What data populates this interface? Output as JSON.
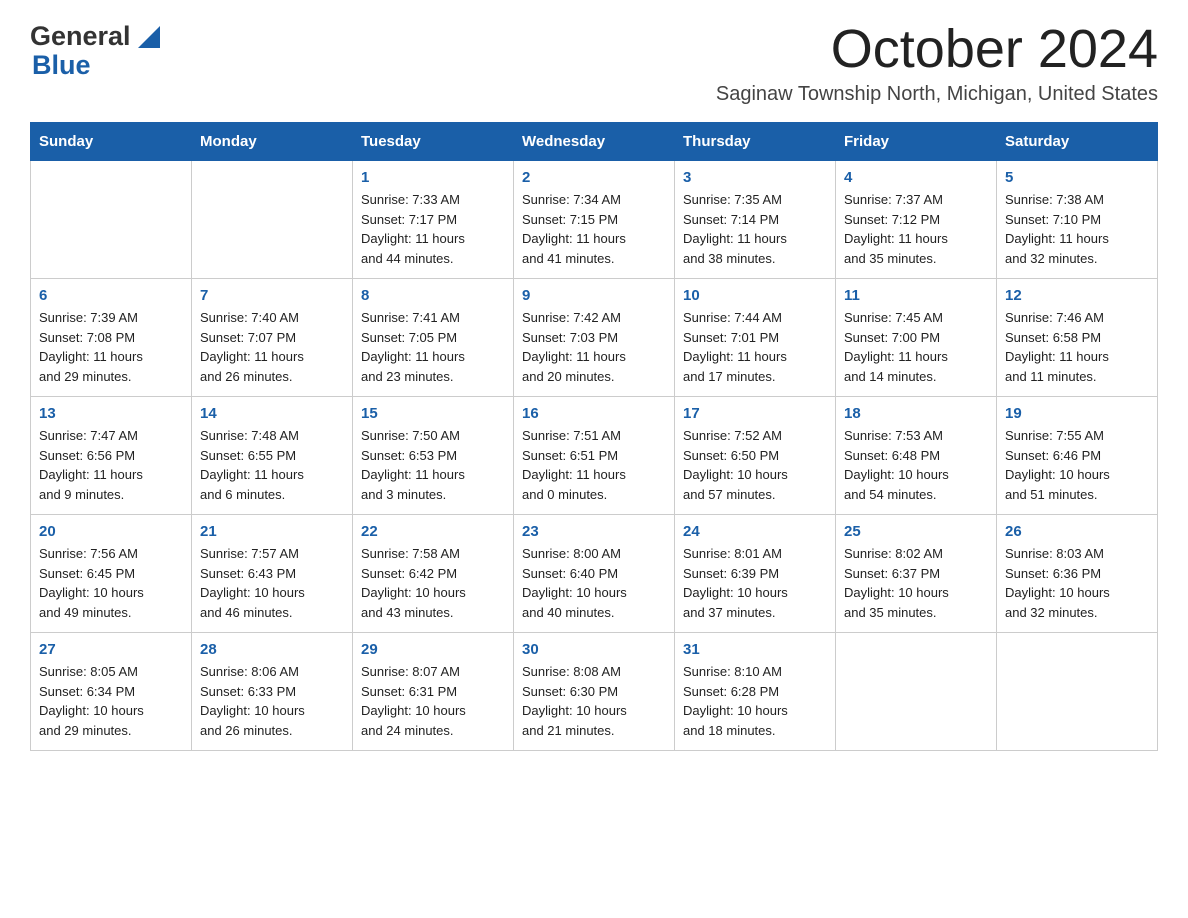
{
  "header": {
    "logo": {
      "general": "General",
      "blue": "Blue",
      "triangle_color": "#1a5fa8"
    },
    "title": "October 2024",
    "subtitle": "Saginaw Township North, Michigan, United States"
  },
  "calendar": {
    "days_of_week": [
      "Sunday",
      "Monday",
      "Tuesday",
      "Wednesday",
      "Thursday",
      "Friday",
      "Saturday"
    ],
    "weeks": [
      [
        {
          "day": "",
          "info": ""
        },
        {
          "day": "",
          "info": ""
        },
        {
          "day": "1",
          "info": "Sunrise: 7:33 AM\nSunset: 7:17 PM\nDaylight: 11 hours\nand 44 minutes."
        },
        {
          "day": "2",
          "info": "Sunrise: 7:34 AM\nSunset: 7:15 PM\nDaylight: 11 hours\nand 41 minutes."
        },
        {
          "day": "3",
          "info": "Sunrise: 7:35 AM\nSunset: 7:14 PM\nDaylight: 11 hours\nand 38 minutes."
        },
        {
          "day": "4",
          "info": "Sunrise: 7:37 AM\nSunset: 7:12 PM\nDaylight: 11 hours\nand 35 minutes."
        },
        {
          "day": "5",
          "info": "Sunrise: 7:38 AM\nSunset: 7:10 PM\nDaylight: 11 hours\nand 32 minutes."
        }
      ],
      [
        {
          "day": "6",
          "info": "Sunrise: 7:39 AM\nSunset: 7:08 PM\nDaylight: 11 hours\nand 29 minutes."
        },
        {
          "day": "7",
          "info": "Sunrise: 7:40 AM\nSunset: 7:07 PM\nDaylight: 11 hours\nand 26 minutes."
        },
        {
          "day": "8",
          "info": "Sunrise: 7:41 AM\nSunset: 7:05 PM\nDaylight: 11 hours\nand 23 minutes."
        },
        {
          "day": "9",
          "info": "Sunrise: 7:42 AM\nSunset: 7:03 PM\nDaylight: 11 hours\nand 20 minutes."
        },
        {
          "day": "10",
          "info": "Sunrise: 7:44 AM\nSunset: 7:01 PM\nDaylight: 11 hours\nand 17 minutes."
        },
        {
          "day": "11",
          "info": "Sunrise: 7:45 AM\nSunset: 7:00 PM\nDaylight: 11 hours\nand 14 minutes."
        },
        {
          "day": "12",
          "info": "Sunrise: 7:46 AM\nSunset: 6:58 PM\nDaylight: 11 hours\nand 11 minutes."
        }
      ],
      [
        {
          "day": "13",
          "info": "Sunrise: 7:47 AM\nSunset: 6:56 PM\nDaylight: 11 hours\nand 9 minutes."
        },
        {
          "day": "14",
          "info": "Sunrise: 7:48 AM\nSunset: 6:55 PM\nDaylight: 11 hours\nand 6 minutes."
        },
        {
          "day": "15",
          "info": "Sunrise: 7:50 AM\nSunset: 6:53 PM\nDaylight: 11 hours\nand 3 minutes."
        },
        {
          "day": "16",
          "info": "Sunrise: 7:51 AM\nSunset: 6:51 PM\nDaylight: 11 hours\nand 0 minutes."
        },
        {
          "day": "17",
          "info": "Sunrise: 7:52 AM\nSunset: 6:50 PM\nDaylight: 10 hours\nand 57 minutes."
        },
        {
          "day": "18",
          "info": "Sunrise: 7:53 AM\nSunset: 6:48 PM\nDaylight: 10 hours\nand 54 minutes."
        },
        {
          "day": "19",
          "info": "Sunrise: 7:55 AM\nSunset: 6:46 PM\nDaylight: 10 hours\nand 51 minutes."
        }
      ],
      [
        {
          "day": "20",
          "info": "Sunrise: 7:56 AM\nSunset: 6:45 PM\nDaylight: 10 hours\nand 49 minutes."
        },
        {
          "day": "21",
          "info": "Sunrise: 7:57 AM\nSunset: 6:43 PM\nDaylight: 10 hours\nand 46 minutes."
        },
        {
          "day": "22",
          "info": "Sunrise: 7:58 AM\nSunset: 6:42 PM\nDaylight: 10 hours\nand 43 minutes."
        },
        {
          "day": "23",
          "info": "Sunrise: 8:00 AM\nSunset: 6:40 PM\nDaylight: 10 hours\nand 40 minutes."
        },
        {
          "day": "24",
          "info": "Sunrise: 8:01 AM\nSunset: 6:39 PM\nDaylight: 10 hours\nand 37 minutes."
        },
        {
          "day": "25",
          "info": "Sunrise: 8:02 AM\nSunset: 6:37 PM\nDaylight: 10 hours\nand 35 minutes."
        },
        {
          "day": "26",
          "info": "Sunrise: 8:03 AM\nSunset: 6:36 PM\nDaylight: 10 hours\nand 32 minutes."
        }
      ],
      [
        {
          "day": "27",
          "info": "Sunrise: 8:05 AM\nSunset: 6:34 PM\nDaylight: 10 hours\nand 29 minutes."
        },
        {
          "day": "28",
          "info": "Sunrise: 8:06 AM\nSunset: 6:33 PM\nDaylight: 10 hours\nand 26 minutes."
        },
        {
          "day": "29",
          "info": "Sunrise: 8:07 AM\nSunset: 6:31 PM\nDaylight: 10 hours\nand 24 minutes."
        },
        {
          "day": "30",
          "info": "Sunrise: 8:08 AM\nSunset: 6:30 PM\nDaylight: 10 hours\nand 21 minutes."
        },
        {
          "day": "31",
          "info": "Sunrise: 8:10 AM\nSunset: 6:28 PM\nDaylight: 10 hours\nand 18 minutes."
        },
        {
          "day": "",
          "info": ""
        },
        {
          "day": "",
          "info": ""
        }
      ]
    ]
  }
}
